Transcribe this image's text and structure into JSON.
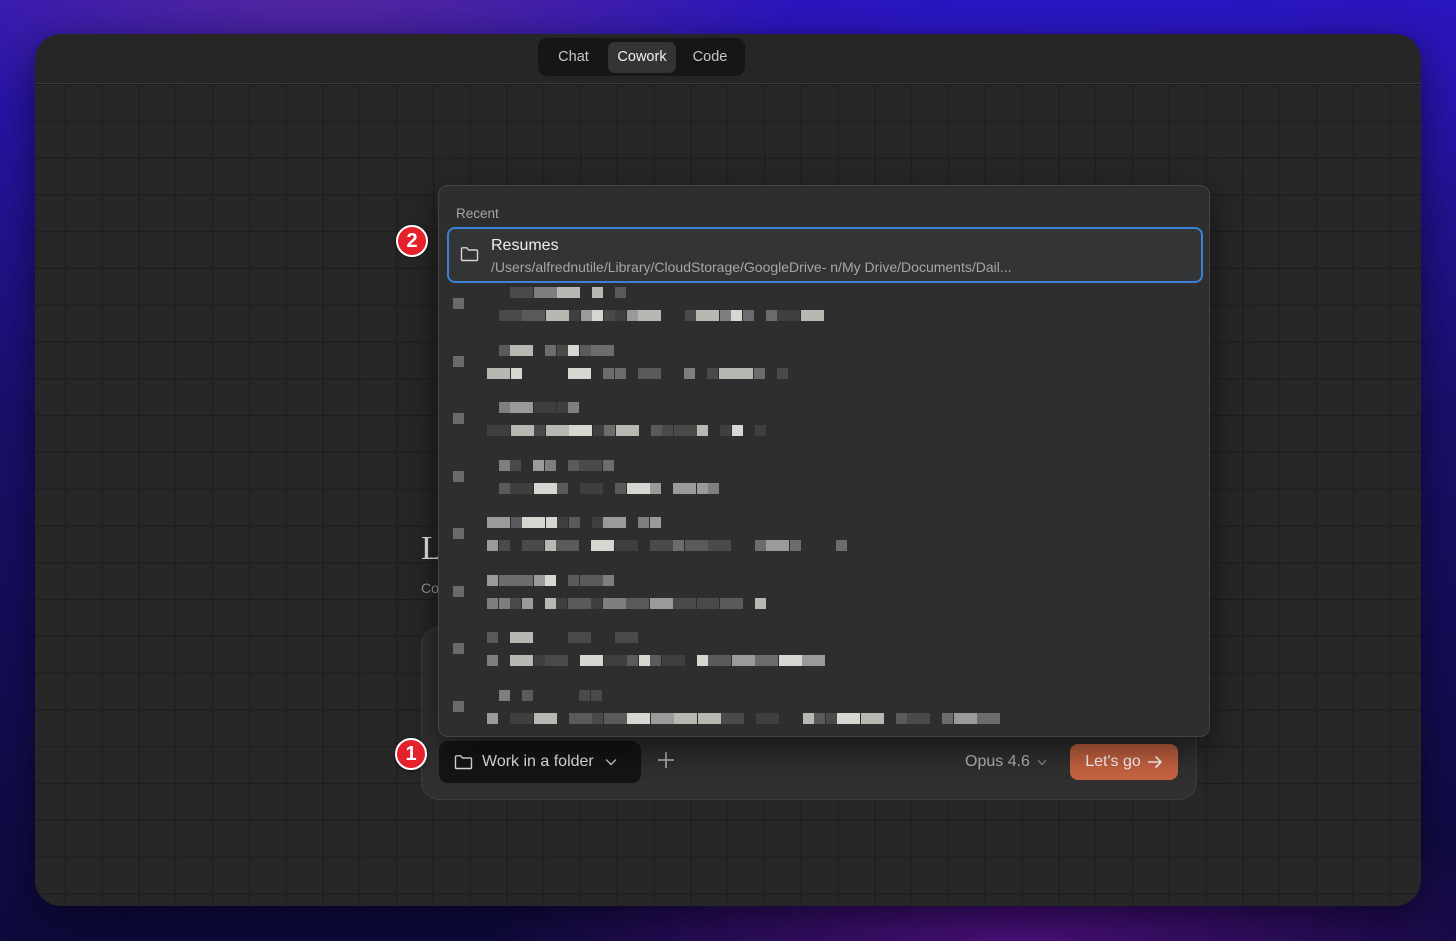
{
  "mode_switch": {
    "tabs": [
      {
        "label": "Chat",
        "active": false
      },
      {
        "label": "Cowork",
        "active": true
      },
      {
        "label": "Code",
        "active": false
      }
    ]
  },
  "background_text": {
    "heading_fragment": "L",
    "subtitle_fragment": "Co"
  },
  "composer": {
    "folder_button_label": "Work in a folder",
    "model_label": "Opus 4.6",
    "submit_label": "Let's go"
  },
  "dropdown": {
    "header": "Recent",
    "selected_item": {
      "name": "Resumes",
      "path": "/Users/alfrednutile/Library/CloudStorage/GoogleDrive-                   n/My Drive/Documents/Dail..."
    },
    "redacted_item_count": 8
  },
  "annotations": {
    "badge_1": "1",
    "badge_2": "2",
    "badge_color": "#e5212c"
  },
  "colors": {
    "accent_button": "#c96442",
    "selection_border": "#3b82d6",
    "window_bg": "#272727"
  },
  "icons": [
    "folder-icon",
    "chevron-down-icon",
    "plus-icon",
    "arrow-right-icon"
  ]
}
